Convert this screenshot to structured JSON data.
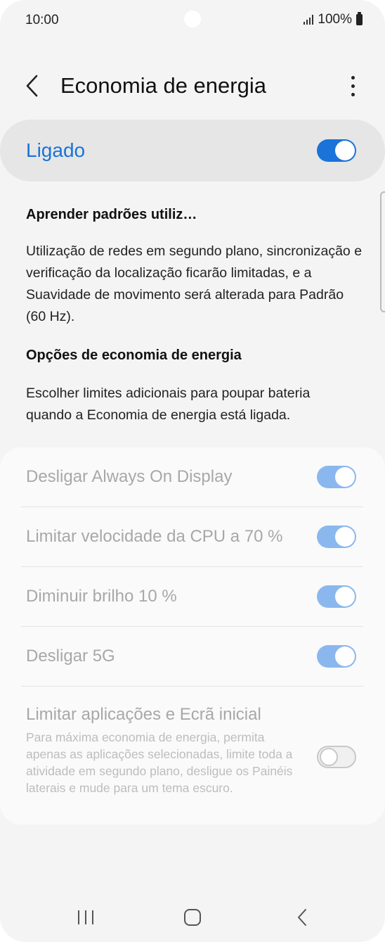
{
  "status_bar": {
    "time": "10:00",
    "battery": "100%",
    "icons": [
      "signal-icon",
      "battery-icon"
    ]
  },
  "header": {
    "title": "Economia de energia",
    "back_icon": "chevron-left-icon",
    "more_icon": "more-vertical-icon"
  },
  "master_switch": {
    "label": "Ligado",
    "state": "on",
    "accent_color": "#1a73d8"
  },
  "sections": {
    "learn_heading": "Aprender padrões utiliz…",
    "learn_text": "Utilização de redes em segundo plano, sincronização e verificação da localização ficarão limitadas, e a Suavidade de movimento será alterada para Padrão (60 Hz).",
    "options_heading": "Opções de economia de energia",
    "options_text": "Escolher limites adicionais para poupar bateria quando a Economia de energia está ligada."
  },
  "options": [
    {
      "label": "Desligar Always On Display",
      "state": "on"
    },
    {
      "label": "Limitar velocidade da CPU a 70 %",
      "state": "on"
    },
    {
      "label": "Diminuir brilho 10 %",
      "state": "on"
    },
    {
      "label": "Desligar 5G",
      "state": "on"
    },
    {
      "label": "Limitar aplicações e Ecrã inicial",
      "description": "Para máxima economia de energia, permita apenas as aplicações selecionadas, limite toda a atividade em segundo plano, desligue os Painéis laterais e mude para um tema escuro.",
      "state": "off"
    }
  ],
  "nav_bar": {
    "recents_icon": "recents-icon",
    "home_icon": "home-icon",
    "back_icon": "back-icon"
  }
}
